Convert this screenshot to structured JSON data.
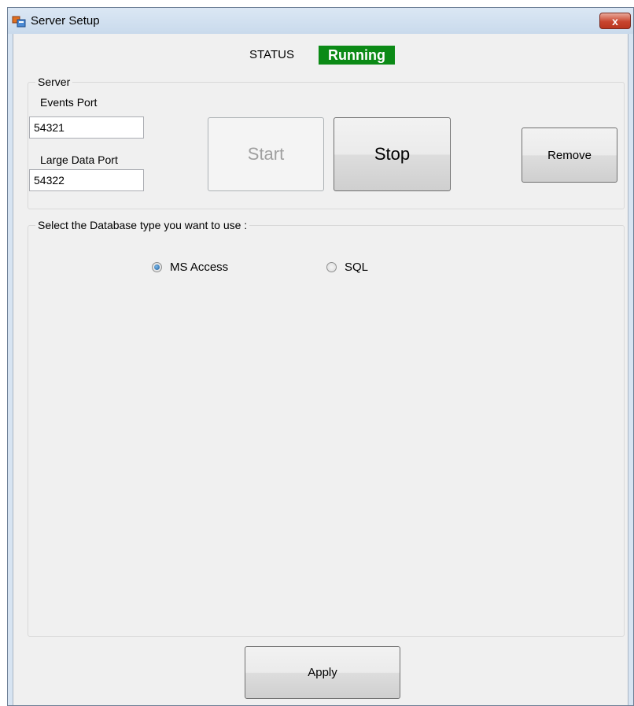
{
  "window": {
    "title": "Server Setup",
    "close_glyph": "x",
    "app_icon": "window-app-icon"
  },
  "status": {
    "label": "STATUS",
    "value": "Running",
    "color": "#0b8a16"
  },
  "server_group": {
    "title": "Server",
    "events_port_label": "Events Port",
    "events_port_value": "54321",
    "large_data_port_label": "Large Data Port",
    "large_data_port_value": "54322",
    "start_label": "Start",
    "stop_label": "Stop",
    "remove_label": "Remove"
  },
  "database_group": {
    "title": "Select the Database type you want to use :",
    "options": [
      {
        "label": "MS Access",
        "selected": true
      },
      {
        "label": "SQL",
        "selected": false
      }
    ]
  },
  "footer": {
    "apply_label": "Apply"
  }
}
